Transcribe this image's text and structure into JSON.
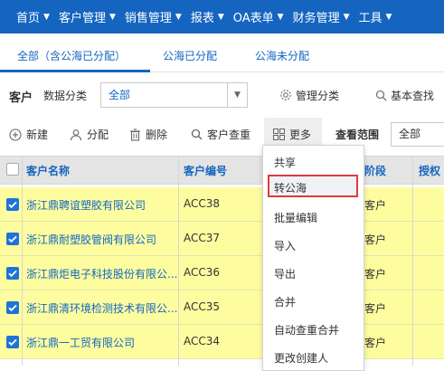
{
  "nav": {
    "items": [
      {
        "label": "首页"
      },
      {
        "label": "客户管理"
      },
      {
        "label": "销售管理"
      },
      {
        "label": "报表"
      },
      {
        "label": "OA表单"
      },
      {
        "label": "财务管理"
      },
      {
        "label": "工具"
      }
    ],
    "bg_color": "#1565c0"
  },
  "tabs": [
    {
      "label": "全部（含公海已分配）",
      "active": true
    },
    {
      "label": "公海已分配",
      "active": false
    },
    {
      "label": "公海未分配",
      "active": false
    }
  ],
  "filter": {
    "section_label": "客户",
    "category_label": "数据分类",
    "category_value": "全部",
    "manage_label": "管理分类",
    "search_label": "基本查找"
  },
  "toolbar": {
    "new_label": "新建",
    "assign_label": "分配",
    "delete_label": "删除",
    "dedupe_label": "客户查重",
    "more_label": "更多",
    "scope_label": "查看范围",
    "scope_value": "全部"
  },
  "table": {
    "columns": [
      "客户名称",
      "客户编号",
      "阶段",
      "授权"
    ],
    "rows": [
      {
        "name": "浙江鼎聘谊塑胶有限公司",
        "code": "ACC38",
        "stage": "客户",
        "checked": true
      },
      {
        "name": "浙江鼎耐塑胶管阀有限公司",
        "code": "ACC37",
        "stage": "客户",
        "checked": true
      },
      {
        "name": "浙江鼎炬电子科技股份有限公...",
        "code": "ACC36",
        "stage": "客户",
        "checked": true
      },
      {
        "name": "浙江鼎清环境检测技术有限公...",
        "code": "ACC35",
        "stage": "客户",
        "checked": true
      },
      {
        "name": "浙江鼎一工贸有限公司",
        "code": "ACC34",
        "stage": "客户",
        "checked": true
      }
    ],
    "row_color": "#fdfda0"
  },
  "more_menu": {
    "items": [
      "共享",
      "转公海",
      "批量编辑",
      "导入",
      "导出",
      "合并",
      "自动查重合并",
      "更改创建人"
    ],
    "highlighted": "转公海",
    "highlight_color": "#e03a3a"
  }
}
